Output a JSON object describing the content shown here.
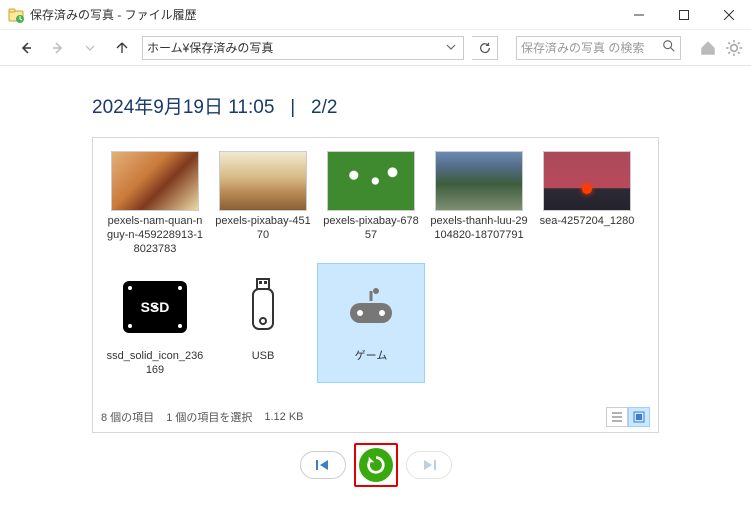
{
  "window": {
    "title": "保存済みの写真 - ファイル履歴"
  },
  "nav": {
    "address": "ホーム¥保存済みの写真",
    "search_placeholder": "保存済みの写真 の検索"
  },
  "heading": {
    "datetime": "2024年9月19日 11:05",
    "separator": "|",
    "page": "2/2"
  },
  "items": [
    {
      "label": "pexels-nam-quan-nguy-n-459228913-18023783",
      "kind": "image",
      "art": "art1"
    },
    {
      "label": "pexels-pixabay-45170",
      "kind": "image",
      "art": "art2"
    },
    {
      "label": "pexels-pixabay-67857",
      "kind": "image",
      "art": "art3"
    },
    {
      "label": "pexels-thanh-luu-29104820-18707791",
      "kind": "image",
      "art": "art4"
    },
    {
      "label": "sea-4257204_1280",
      "kind": "image",
      "art": "art5"
    },
    {
      "label": "ssd_solid_icon_236169",
      "kind": "ssd"
    },
    {
      "label": "USB",
      "kind": "usb"
    },
    {
      "label": "ゲーム",
      "kind": "game",
      "selected": true
    }
  ],
  "status": {
    "count": "8 個の項目",
    "selection": "1 個の項目を選択",
    "size": "1.12 KB"
  },
  "controls": {
    "prev": "previous-version",
    "restore": "restore",
    "next": "next-version"
  }
}
